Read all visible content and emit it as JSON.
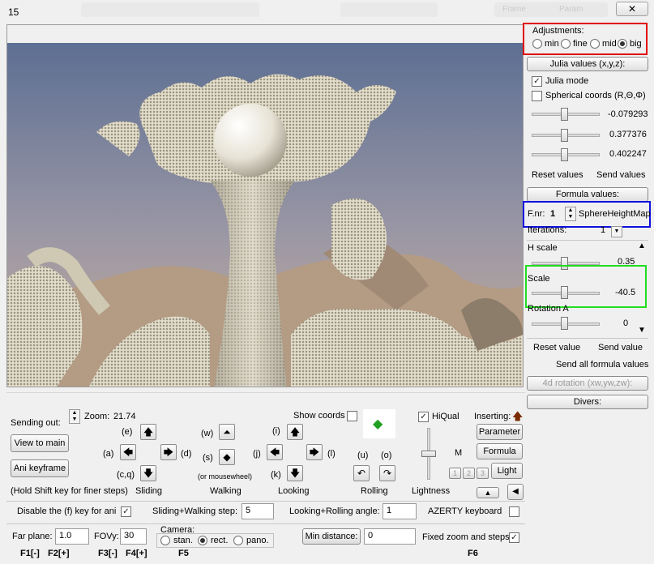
{
  "window": {
    "title": "15",
    "close": "✕",
    "hidden_1": "Frame",
    "hidden_2": "Param"
  },
  "colors": {
    "highlight_red": "#e00000",
    "highlight_blue": "#1010dd",
    "highlight_green": "#20dd20"
  },
  "adjustments": {
    "title": "Adjustments:",
    "options": [
      "min",
      "fine",
      "mid",
      "big"
    ],
    "selected": "big"
  },
  "julia": {
    "header": "Julia values (x,y,z):",
    "julia_mode_label": "Julia mode",
    "julia_mode_checked": true,
    "spherical_label": "Spherical coords  (R,Θ,Φ)",
    "spherical_checked": false,
    "values": [
      "-0.079293",
      "0.377376",
      "0.402247"
    ],
    "reset": "Reset values",
    "send": "Send values"
  },
  "formula": {
    "header": "Formula values:",
    "fnr_label": "F.nr:",
    "fnr_value": "1",
    "formula_name": "SphereHeightMap",
    "iterations_label": "Iterations:",
    "iterations_value": "1",
    "params": [
      {
        "label": "H scale",
        "value": "0.35"
      },
      {
        "label": "Scale",
        "value": "-40.5"
      },
      {
        "label": "Rotation A",
        "value": "0"
      }
    ],
    "reset": "Reset value",
    "send": "Send value",
    "send_all": "Send all formula values",
    "rotation4d": "4d rotation (xw,yw,zw):",
    "divers": "Divers:"
  },
  "nav": {
    "sending_out": "Sending out:",
    "zoom_label": "Zoom:",
    "zoom_value": "21.74",
    "view_to_main": "View to main",
    "ani_keyframe": "Ani keyframe",
    "hold_shift": "(Hold Shift key for finer steps)",
    "show_coords": "Show coords",
    "keys": {
      "e": "(e)",
      "a": "(a)",
      "d": "(d)",
      "cq": "(c,q)",
      "w": "(w)",
      "s": "(s)",
      "i": "(i)",
      "j": "(j)",
      "l": "(l)",
      "k": "(k)",
      "u": "(u)",
      "o": "(o)"
    },
    "mousewheel": "(or mousewheel)",
    "groups": [
      "Sliding",
      "Walking",
      "Looking",
      "Rolling",
      "Lightness"
    ],
    "hiqual": "HiQual",
    "inserting": "Inserting:",
    "parameter": "Parameter",
    "formula_btn": "Formula",
    "light_btn": "Light",
    "m_label": "M",
    "light_nums": [
      "1",
      "2",
      "3"
    ]
  },
  "options_row": {
    "disable_f": "Disable the (f) key for ani",
    "disable_f_checked": true,
    "step_label": "Sliding+Walking step:",
    "step_value": "5",
    "angle_label": "Looking+Rolling angle:",
    "angle_value": "1",
    "azerty": "AZERTY keyboard",
    "azerty_checked": false
  },
  "camera_row": {
    "far_label": "Far plane:",
    "far_value": "1.0",
    "fov_label": "FOVy:",
    "fov_value": "30",
    "camera_label": "Camera:",
    "camera_options": [
      "stan.",
      "rect.",
      "pano."
    ],
    "camera_selected": "rect.",
    "min_distance": "Min distance:",
    "min_distance_value": "0",
    "fixed_zoom": "Fixed zoom and steps",
    "fixed_zoom_checked": true
  },
  "fkeys": {
    "f1": "F1[-]",
    "f2": "F2[+]",
    "f3": "F3[-]",
    "f4": "F4[+]",
    "f5": "F5",
    "f6": "F6"
  }
}
